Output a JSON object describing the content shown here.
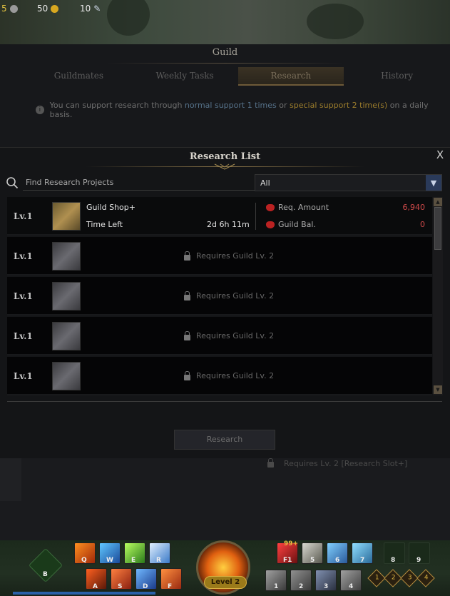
{
  "currency": [
    {
      "amount": "5",
      "icon": "silver-coin-icon",
      "color": "#9a9a9a"
    },
    {
      "amount": "50",
      "icon": "gold-coin-icon",
      "color": "#d8a820"
    },
    {
      "amount": "10",
      "icon": "feather-icon",
      "color": "#cfd8e8"
    }
  ],
  "guild": {
    "title": "Guild",
    "tabs": [
      "Guildmates",
      "Weekly Tasks",
      "Research",
      "History"
    ],
    "active_tab": "Research",
    "info": {
      "prefix": "You can support research through ",
      "normal": "normal support 1 times",
      "mid": " or ",
      "special": "special support 2 time(s)",
      "suffix": " on a daily basis."
    }
  },
  "research_list": {
    "title": "Research List",
    "close_label": "X",
    "search": {
      "placeholder": "Find Research Projects",
      "value": ""
    },
    "filter": {
      "selected": "All"
    },
    "items": [
      {
        "level": "Lv.1",
        "name": "Guild Shop+",
        "time_left_label": "Time Left",
        "time_left": "2d 6h 11m",
        "req_amount_label": "Req. Amount",
        "req_amount": "6,940",
        "guild_bal_label": "Guild Bal.",
        "guild_bal": "0"
      },
      {
        "level": "Lv.1",
        "locked_text": "Requires Guild Lv. 2"
      },
      {
        "level": "Lv.1",
        "locked_text": "Requires Guild Lv. 2"
      },
      {
        "level": "Lv.1",
        "locked_text": "Requires Guild Lv. 2"
      },
      {
        "level": "Lv.1",
        "locked_text": "Requires Guild Lv. 2"
      }
    ],
    "research_button": "Research"
  },
  "below_note": "Requires Lv. 2 [Research Slot+]",
  "hotbar": {
    "skills_top_keys": [
      "Q",
      "W",
      "E",
      "R"
    ],
    "skills_bottom_keys": [
      "A",
      "S",
      "D",
      "F"
    ],
    "item_keys": [
      "F1",
      "5",
      "6",
      "7",
      "8",
      "9"
    ],
    "item_bottom_keys": [
      "1",
      "2",
      "3",
      "4"
    ],
    "potion_count": "99+",
    "level_label": "Level 2",
    "gem_labels": [
      "1",
      "2",
      "3",
      "4"
    ],
    "b_key": "B"
  }
}
